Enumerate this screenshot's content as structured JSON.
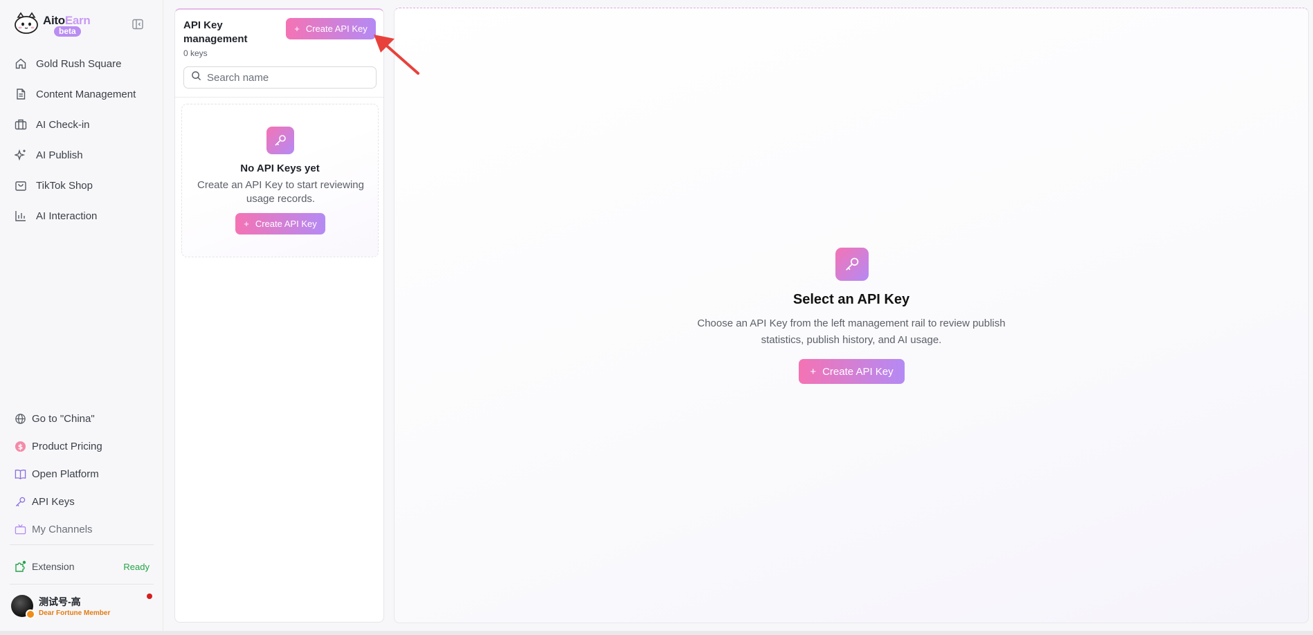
{
  "brand": {
    "name_part1": "Aito",
    "name_part2": "Earn",
    "badge": "beta"
  },
  "nav": [
    {
      "label": "Gold Rush Square",
      "icon": "home-icon"
    },
    {
      "label": "Content Management",
      "icon": "document-icon"
    },
    {
      "label": "AI Check-in",
      "icon": "briefcase-icon"
    },
    {
      "label": "AI Publish",
      "icon": "sparkle-icon"
    },
    {
      "label": "TikTok Shop",
      "icon": "shopping-bag-icon"
    },
    {
      "label": "AI Interaction",
      "icon": "bar-chart-icon"
    }
  ],
  "bottom_nav": [
    {
      "label": "Go to \"China\"",
      "icon": "globe-icon"
    },
    {
      "label": "Product Pricing",
      "icon": "dollar-circle-icon"
    },
    {
      "label": "Open Platform",
      "icon": "book-open-icon"
    },
    {
      "label": "API Keys",
      "icon": "key-icon"
    },
    {
      "label": "My Channels",
      "icon": "tv-icon"
    }
  ],
  "extension": {
    "label": "Extension",
    "status": "Ready"
  },
  "user": {
    "name": "测试号-高",
    "tier": "Dear Fortune Member"
  },
  "rail": {
    "title": "API Key management",
    "count": "0 keys",
    "create_label": "Create API Key",
    "search_placeholder": "Search name",
    "empty_title": "No API Keys yet",
    "empty_desc": "Create an API Key to start reviewing usage records.",
    "empty_create_label": "Create API Key"
  },
  "main": {
    "title": "Select an API Key",
    "desc_line1": "Choose an API Key from the left management rail to review publish",
    "desc_line2": "statistics, publish history, and AI usage.",
    "create_label": "Create API Key"
  },
  "colors": {
    "accent_start": "#f473b4",
    "accent_end": "#b48af4",
    "ready": "#22a447",
    "tier": "#e07b12",
    "notification": "#d61d1d",
    "annotation_arrow": "#e8413c"
  }
}
